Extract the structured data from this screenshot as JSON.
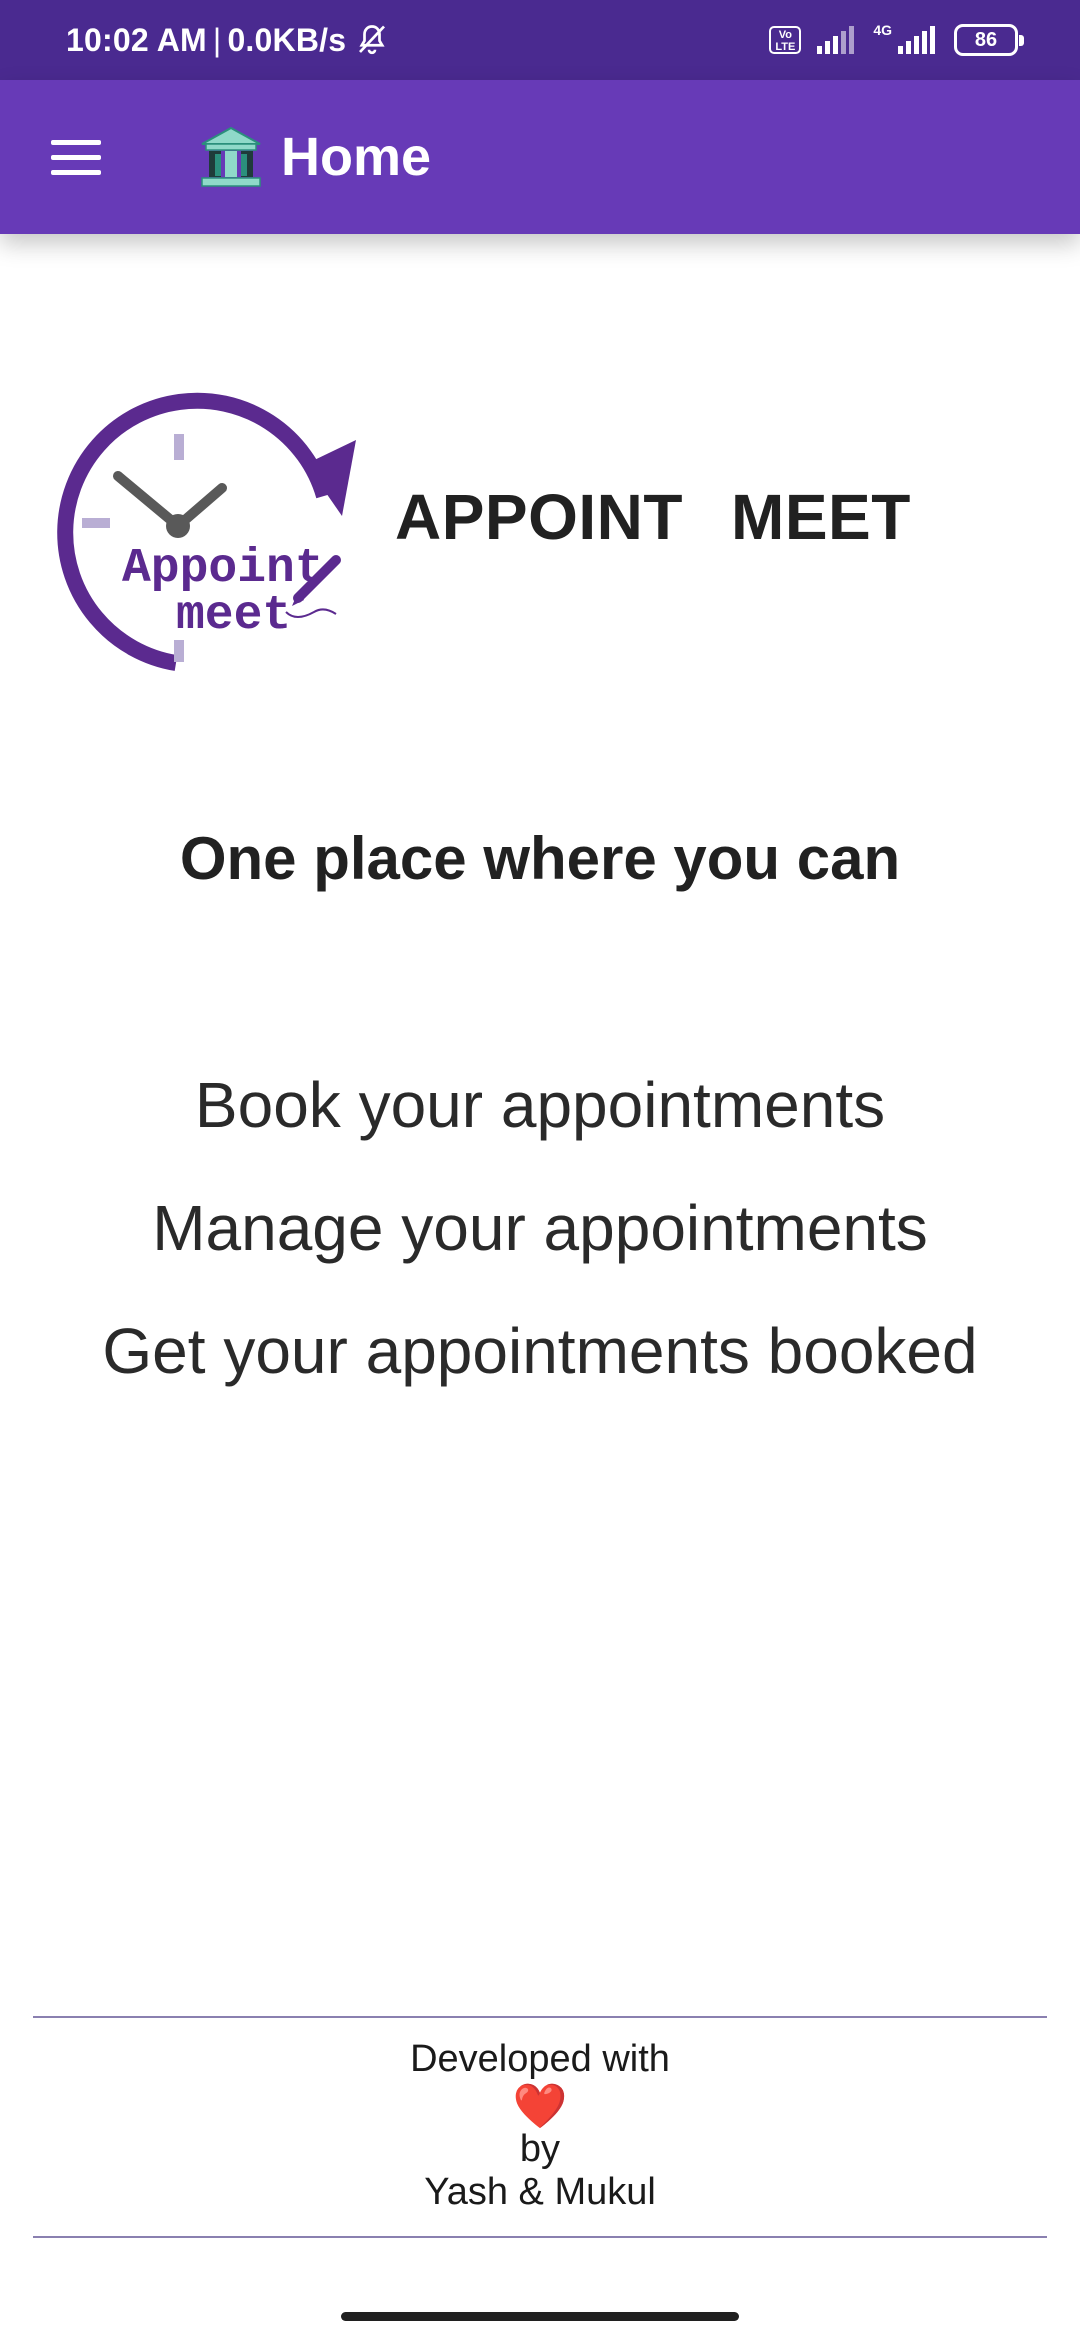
{
  "status_bar": {
    "time": "10:02 AM",
    "separator": "|",
    "network_speed": "0.0KB/s",
    "volte_line1": "Vo",
    "volte_line2": "LTE",
    "net_type": "4G",
    "battery_level": "86"
  },
  "app_bar": {
    "title": "Home",
    "icon": "bank-icon",
    "menu_icon": "menu-icon",
    "color": "#673ab7"
  },
  "logo": {
    "line1": "Appoint",
    "line2": "meet"
  },
  "brand": {
    "word1": "APPOINT",
    "word2": "MEET"
  },
  "tagline": "One place where you can",
  "features": [
    "Book your appointments",
    "Manage your appointments",
    "Get your appointments booked"
  ],
  "footer": {
    "developed_with": "Developed with",
    "heart": "❤️",
    "by": "by",
    "authors": "Yash & Mukul"
  },
  "colors": {
    "status_bar": "#4a2a90",
    "accent": "#673ab7",
    "logo_purple": "#5b2a8f"
  }
}
